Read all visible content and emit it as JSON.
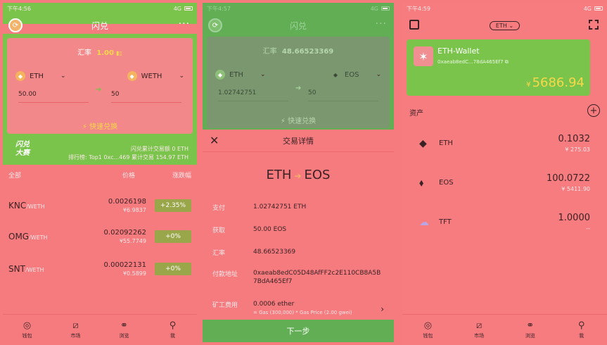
{
  "screen1": {
    "status": {
      "time": "下午4:56",
      "signal": "4G"
    },
    "title": "闪兑",
    "more": "···",
    "rate_label": "汇率",
    "rate_value": "1.00",
    "from_token": "ETH",
    "to_token": "WETH",
    "from_amount": "50.00",
    "to_amount": "50",
    "quick_swap": "快速兑换",
    "banner": {
      "brand_line1": "闪兑",
      "brand_line2": "大赛",
      "line1": "闪兑累计交易额 0 ETH",
      "line2": "排行榜: Top1 0xc...469 累计交易 154.97 ETH"
    },
    "list_headers": [
      "全部",
      "价格",
      "涨跌幅"
    ],
    "markets": [
      {
        "symbol": "KNC",
        "quote": "/WETH",
        "price": "0.0026198",
        "fiat": "¥6.9837",
        "change": "+2.35%"
      },
      {
        "symbol": "OMG",
        "quote": "/WETH",
        "price": "0.02092262",
        "fiat": "¥55.7749",
        "change": "+0%"
      },
      {
        "symbol": "SNT",
        "quote": "/WETH",
        "price": "0.00022131",
        "fiat": "¥0.5899",
        "change": "+0%"
      }
    ],
    "tabs": [
      "钱包",
      "市场",
      "浏览",
      "我"
    ]
  },
  "screen2": {
    "status": {
      "time": "下午4:57",
      "signal": "4G"
    },
    "title": "闪兑",
    "more": "···",
    "rate_label": "汇率",
    "rate_value": "48.66523369",
    "from_token": "ETH",
    "to_token": "EOS",
    "from_amount": "1.02742751",
    "to_amount": "50",
    "quick_swap": "快速兑换",
    "sheet_title": "交易详情",
    "pair_from": "ETH",
    "pair_to": "EOS",
    "details": [
      {
        "key": "支付",
        "value": "1.02742751 ETH",
        "sub": ""
      },
      {
        "key": "获取",
        "value": "50.00 EOS",
        "sub": ""
      },
      {
        "key": "汇率",
        "value": "48.66523369",
        "sub": ""
      },
      {
        "key": "付款地址",
        "value": "0xaeab8edC05D48AfFF2c2E110CB8A5B7BdA465Ef7",
        "sub": ""
      },
      {
        "key": "矿工费用",
        "value": "0.0006 ether",
        "sub": "= Gas (300,000) * Gas Price (2.00 gwei)"
      }
    ],
    "next": "下一步"
  },
  "screen3": {
    "status": {
      "time": "下午4:59",
      "signal": "4G"
    },
    "network": "ETH",
    "wallet": {
      "name": "ETH-Wallet",
      "address": "0xaeab8edC...78dA465Ef7",
      "currency": "¥",
      "balance": "5686.94"
    },
    "assets_title": "资产",
    "assets": [
      {
        "symbol": "ETH",
        "amount": "0.1032",
        "fiat": "¥ 275.03",
        "icon": "ethereum-icon"
      },
      {
        "symbol": "EOS",
        "amount": "100.0722",
        "fiat": "¥ 5411.90",
        "icon": "eos-icon"
      },
      {
        "symbol": "TFT",
        "amount": "1.0000",
        "fiat": "--",
        "icon": "tft-icon"
      }
    ],
    "tabs": [
      "钱包",
      "市场",
      "浏览",
      "我"
    ]
  }
}
